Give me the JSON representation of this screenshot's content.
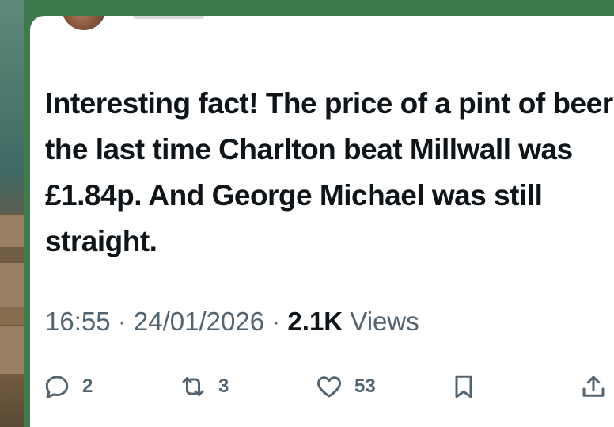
{
  "tweet": {
    "text": "Interesting fact! The price of a pint of beer the last time Charlton beat Millwall was £1.84p. And George Michael was still straight.",
    "time": "16:55",
    "separator": " · ",
    "date": "24/01/2026",
    "views_count": "2.1K",
    "views_label": " Views"
  },
  "actions": {
    "replies": {
      "icon": "reply-icon",
      "count": "2"
    },
    "reposts": {
      "icon": "repost-icon",
      "count": "3"
    },
    "likes": {
      "icon": "heart-icon",
      "count": "53"
    },
    "bookmark": {
      "icon": "bookmark-icon"
    },
    "share": {
      "icon": "share-icon"
    }
  }
}
